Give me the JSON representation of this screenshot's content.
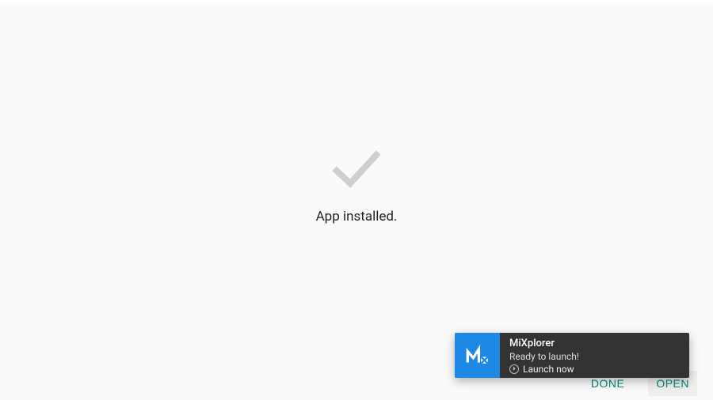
{
  "header": {
    "app_name": "MiXplorer"
  },
  "main": {
    "status": "App installed."
  },
  "footer": {
    "done_label": "DONE",
    "open_label": "OPEN"
  },
  "notification": {
    "title": "MiXplorer",
    "subtitle": "Ready to launch!",
    "action_label": "Launch now"
  },
  "colors": {
    "brand_blue": "#1e88e5",
    "teal_accent": "#00897b",
    "notif_bg": "#333333"
  }
}
